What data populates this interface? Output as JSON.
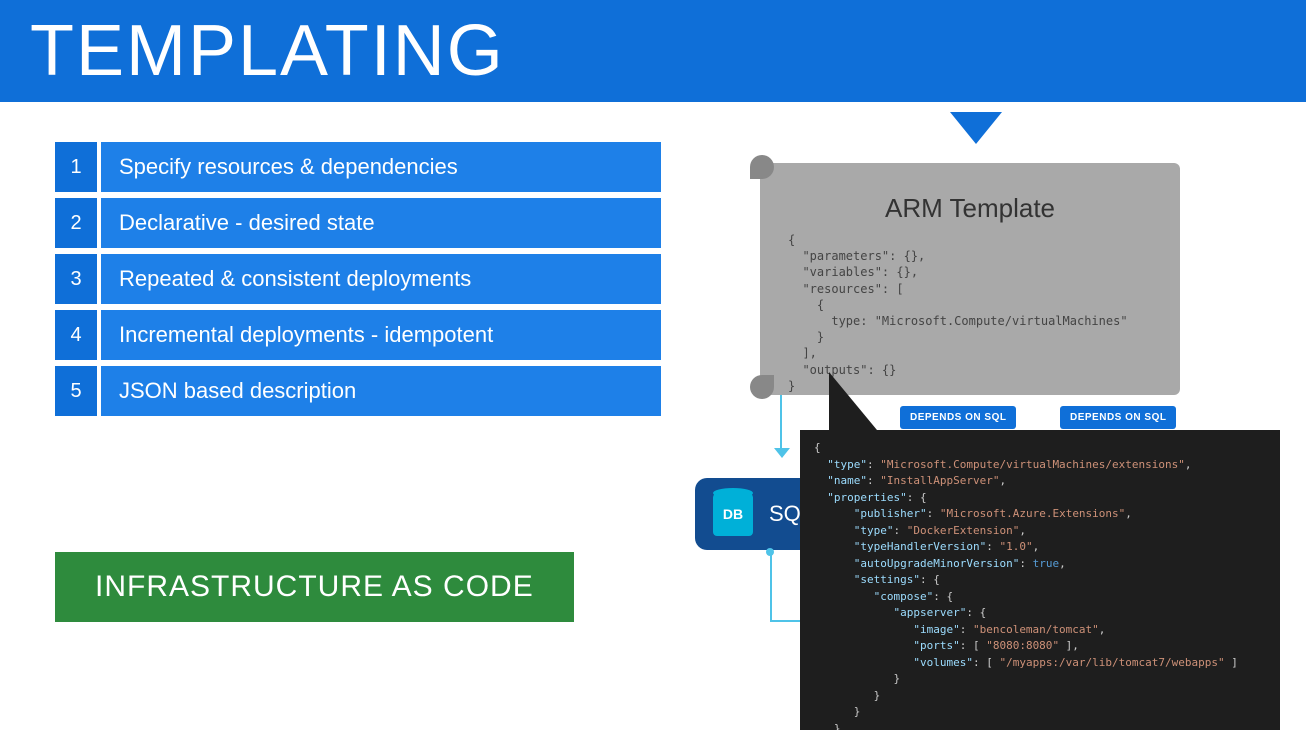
{
  "header": {
    "title": "TEMPLATING"
  },
  "list": [
    {
      "num": "1",
      "text": "Specify resources & dependencies"
    },
    {
      "num": "2",
      "text": "Declarative - desired state"
    },
    {
      "num": "3",
      "text": "Repeated & consistent deployments"
    },
    {
      "num": "4",
      "text": "Incremental deployments - idempotent"
    },
    {
      "num": "5",
      "text": "JSON based description"
    }
  ],
  "badge": {
    "text": "INFRASTRUCTURE AS CODE"
  },
  "scroll": {
    "title": "ARM Template",
    "code": "{\n  \"parameters\": {},\n  \"variables\": {},\n  \"resources\": [\n    {\n      type: \"Microsoft.Compute/virtualMachines\"\n    }\n  ],\n  \"outputs\": {}\n}"
  },
  "dependencies": {
    "label1": "DEPENDS ON SQL",
    "label2": "DEPENDS ON SQL"
  },
  "sql": {
    "icon_text": "DB",
    "label": "SQL"
  },
  "code_overlay": {
    "type": "Microsoft.Compute/virtualMachines/extensions",
    "name": "InstallAppServer",
    "publisher": "Microsoft.Azure.Extensions",
    "ext_type": "DockerExtension",
    "version": "1.0",
    "auto_upgrade": "true",
    "image": "bencoleman/tomcat",
    "ports": "8080:8080",
    "volumes": "/myapps:/var/lib/tomcat7/webapps"
  }
}
